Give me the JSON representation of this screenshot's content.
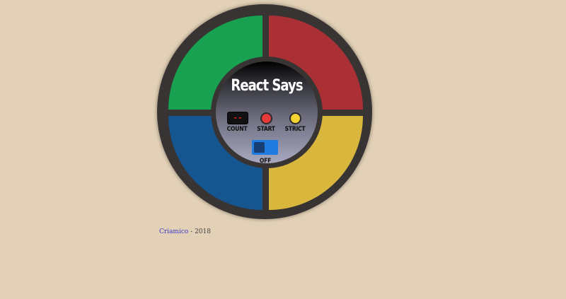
{
  "game": {
    "title": "React Says",
    "count_display": "--",
    "labels": {
      "count": "COUNT",
      "start": "START",
      "strict": "STRICT",
      "power": "OFF"
    },
    "power_on": false
  },
  "colors": {
    "green": "#18a150",
    "red": "#ab3035",
    "blue": "#155590",
    "yellow": "#d8b73c",
    "ring": "#383434",
    "background": "#e3d1b7",
    "toggle": "#1f7be0"
  },
  "footer": {
    "author": "Criamico",
    "separator": " - ",
    "year": "2018"
  }
}
